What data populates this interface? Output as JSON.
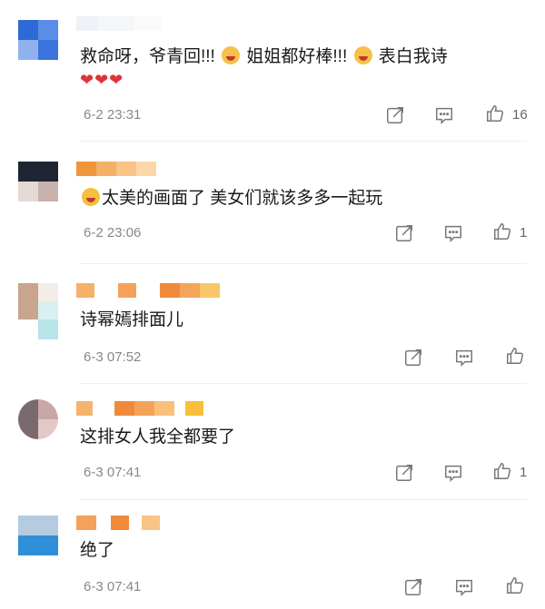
{
  "comments": [
    {
      "text": "救命呀，爷青回!!! ",
      "text2": " 姐姐都好棒!!! ",
      "text3": " 表白我诗",
      "hearts": "❤❤❤",
      "time": "6-2 23:31",
      "likes": "16"
    },
    {
      "text": "太美的画面了 美女们就该多多一起玩",
      "time": "6-2 23:06",
      "likes": "1"
    },
    {
      "text": "诗幂嫣排面儿",
      "time": "6-3 07:52",
      "likes": ""
    },
    {
      "text": "这排女人我全都要了",
      "time": "6-3 07:41",
      "likes": "1"
    },
    {
      "text": "绝了",
      "time": "6-3 07:41",
      "likes": ""
    }
  ],
  "icons": {
    "share": "share-icon",
    "reply": "comment-icon",
    "like": "thumbs-up-icon"
  },
  "colors": {
    "text": "#1a1a1a",
    "meta": "#888888",
    "heart": "#e0343a"
  }
}
